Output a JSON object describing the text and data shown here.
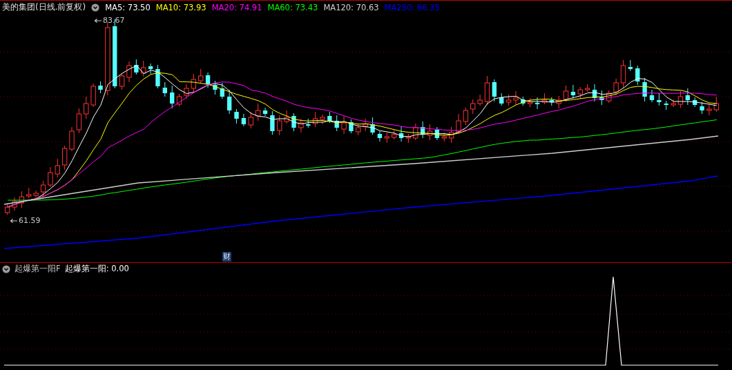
{
  "main_panel": {
    "stock_title": "美的集团(日线.前复权)",
    "indicators": [
      {
        "text": "MA5: 73.50",
        "color": "#ffffff"
      },
      {
        "text": "MA10: 73.93",
        "color": "#ffff00"
      },
      {
        "text": "MA20: 74.91",
        "color": "#ff00ff"
      },
      {
        "text": "MA60: 73.43",
        "color": "#00ff00"
      },
      {
        "text": "MA120: 70.63",
        "color": "#d0d0d0"
      },
      {
        "text": "MA250: 66.35",
        "color": "#0000ff"
      }
    ],
    "high_label": "83.67",
    "low_label": "61.59",
    "finance_badge": "财"
  },
  "sub_panel": {
    "indicator_name": "起爆第一阳F",
    "reading": "起爆第一阳: 0.00"
  }
}
